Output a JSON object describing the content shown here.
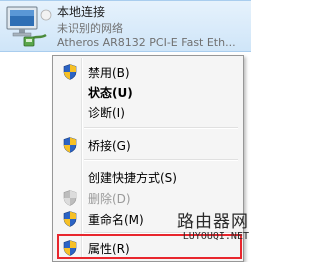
{
  "adapter": {
    "name": "本地连接",
    "status": "未识别的网络",
    "device": "Atheros AR8132 PCI-E Fast Eth..."
  },
  "context_menu": {
    "items": [
      {
        "label": "禁用(B)",
        "icon": "uac-shield-icon",
        "bold": false,
        "disabled": false
      },
      {
        "label": "状态(U)",
        "icon": "",
        "bold": true,
        "disabled": false
      },
      {
        "label": "诊断(I)",
        "icon": "",
        "bold": false,
        "disabled": false
      },
      {
        "label": "桥接(G)",
        "icon": "uac-shield-icon",
        "bold": false,
        "disabled": false
      },
      {
        "label": "创建快捷方式(S)",
        "icon": "",
        "bold": false,
        "disabled": false
      },
      {
        "label": "删除(D)",
        "icon": "uac-shield-icon",
        "bold": false,
        "disabled": true
      },
      {
        "label": "重命名(M)",
        "icon": "uac-shield-icon",
        "bold": false,
        "disabled": false
      },
      {
        "label": "属性(R)",
        "icon": "uac-shield-icon",
        "bold": false,
        "disabled": false
      }
    ]
  },
  "highlight": {
    "target": "属性(R)",
    "color": "#e8262d"
  },
  "watermark": {
    "title": "路由器网",
    "url": "LUYOUQI.NET"
  },
  "colors": {
    "selection_bg": "#cfe5f8",
    "menu_bg": "#f5f5f5",
    "disabled_text": "#9a9a9a"
  }
}
